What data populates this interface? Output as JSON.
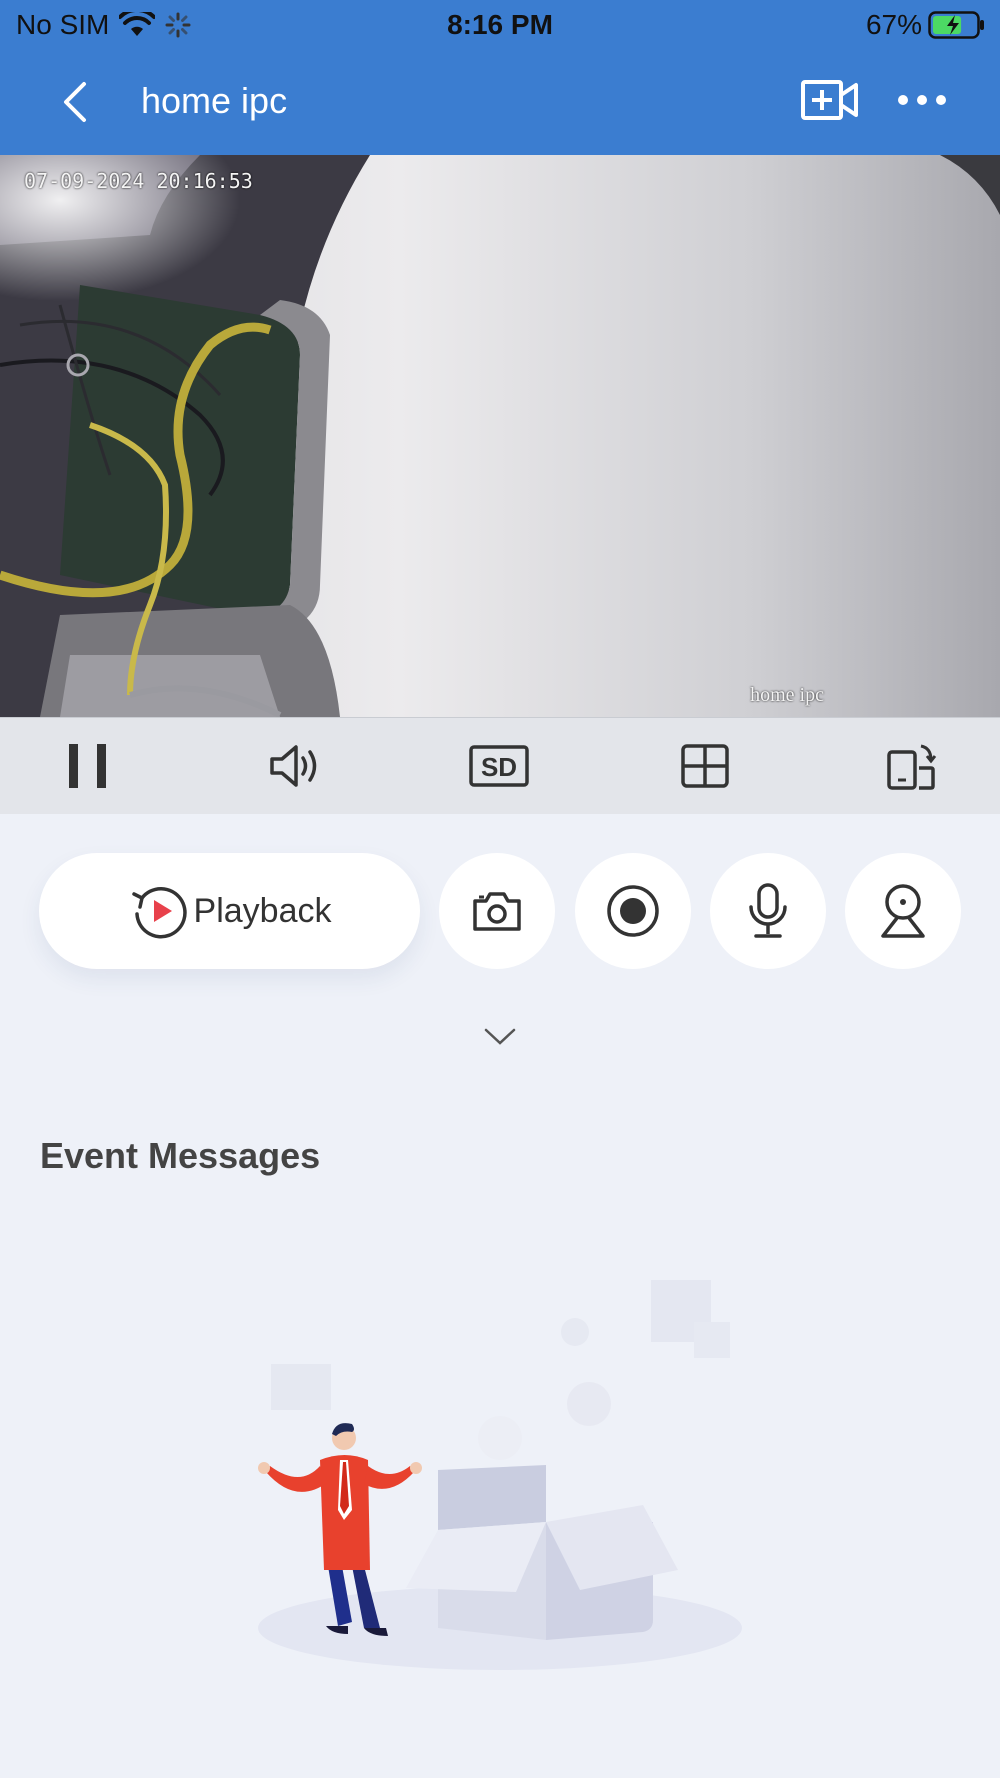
{
  "status_bar": {
    "carrier": "No SIM",
    "time": "8:16 PM",
    "battery": "67%",
    "battery_level": 0.67
  },
  "header": {
    "title": "home ipc",
    "back_icon": "chevron-left-icon",
    "add_icon": "add-camera-icon",
    "more_icon": "more-icon"
  },
  "video": {
    "timestamp": "07-09-2024 20:16:53",
    "overlay_name": "home ipc"
  },
  "controls": {
    "items": [
      "pause-icon",
      "volume-icon",
      "sd-quality-icon",
      "grid-layout-icon",
      "rotate-screen-icon"
    ],
    "sd_label": "SD"
  },
  "actions": {
    "playback_label": "Playback",
    "items": [
      "camera-snapshot-icon",
      "record-icon",
      "microphone-icon",
      "ptz-icon"
    ]
  },
  "events": {
    "title": "Event Messages"
  },
  "colors": {
    "accent": "#3b7dd0",
    "background": "#eef1f8",
    "controls_bar": "#e3e5ea",
    "playback_red": "#e8414b"
  }
}
